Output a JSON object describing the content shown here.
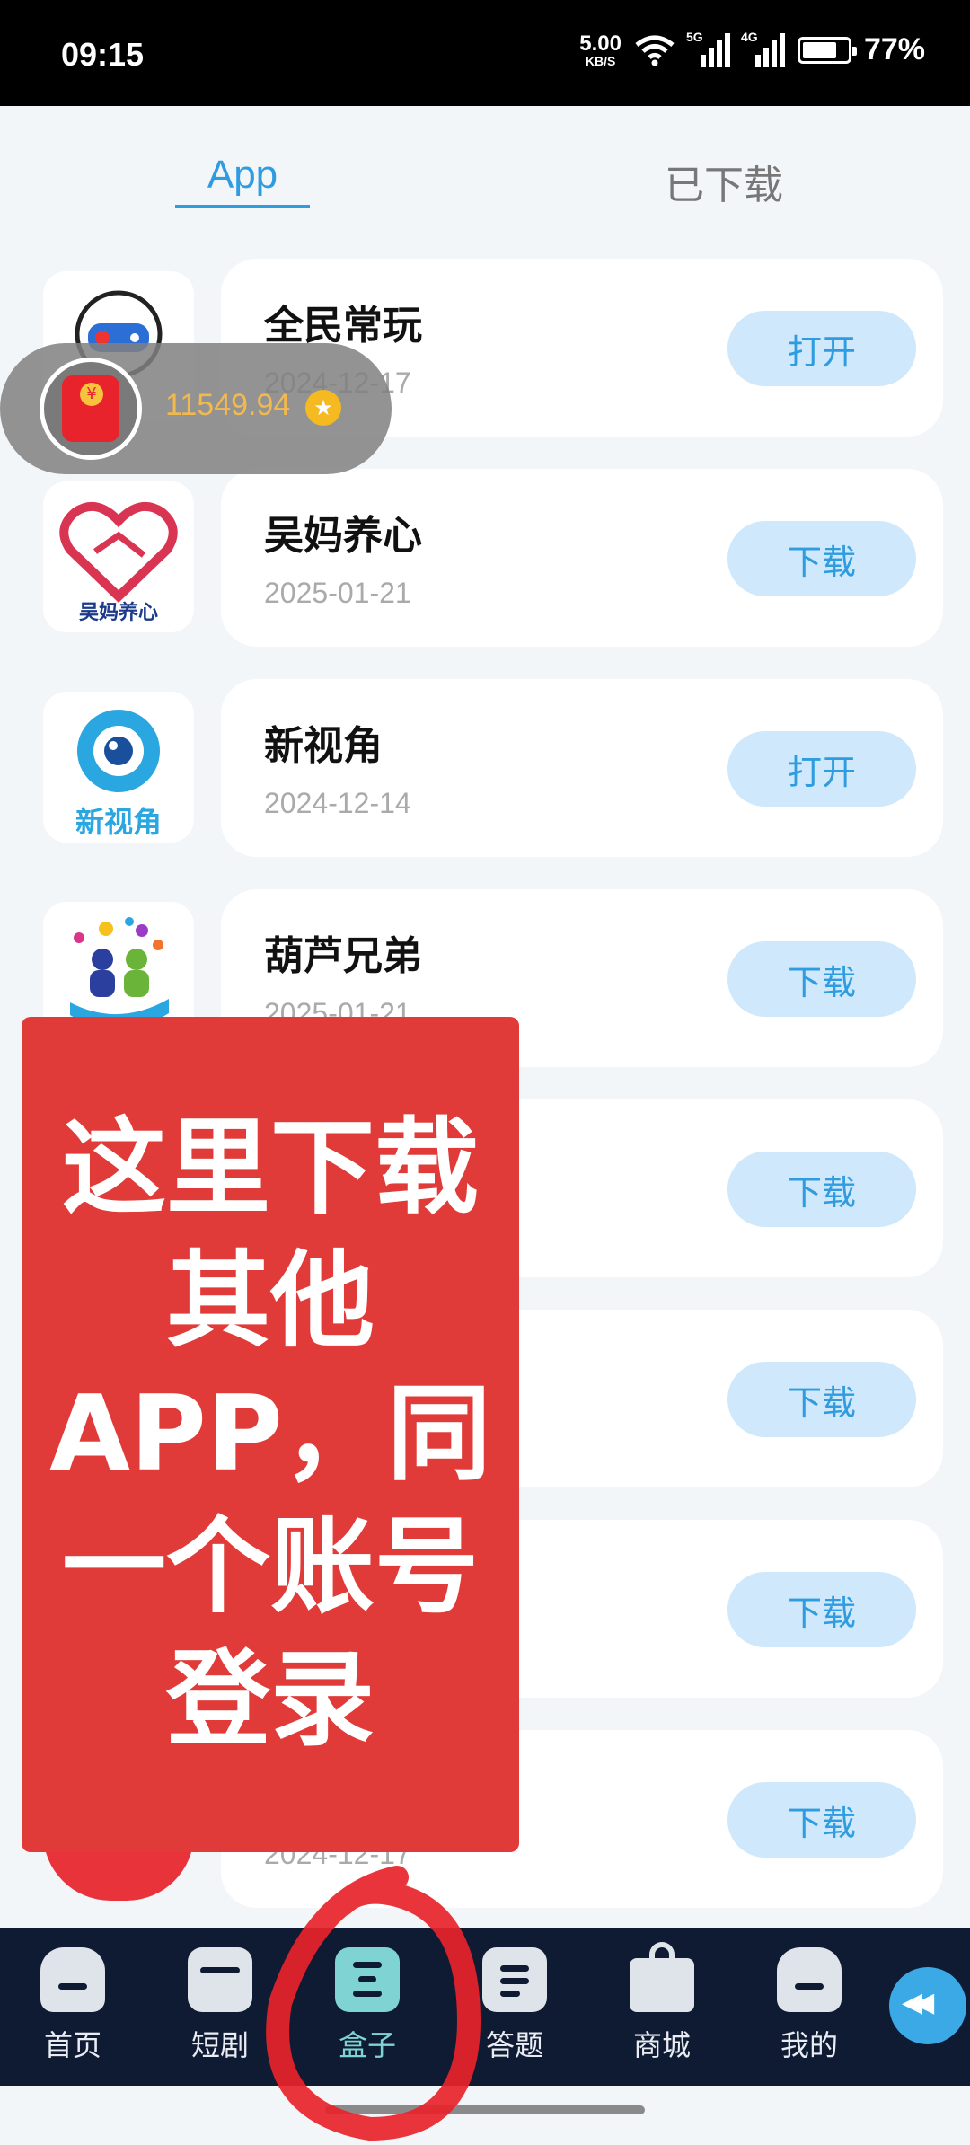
{
  "status_bar": {
    "time": "09:15",
    "net_speed": "5.00",
    "net_unit": "KB/S",
    "sig1_label": "5G",
    "sig2_label": "4G",
    "battery": "77%"
  },
  "tabs": [
    {
      "label": "App"
    },
    {
      "label": "已下载"
    }
  ],
  "apps": [
    {
      "name": "全民常玩",
      "date": "2024-12-17",
      "action": "打开"
    },
    {
      "name": "吴妈养心",
      "date": "2025-01-21",
      "action": "下载",
      "icon_text": "吴妈养心"
    },
    {
      "name": "新视角",
      "date": "2024-12-14",
      "action": "打开",
      "icon_text": "新视角"
    },
    {
      "name": "葫芦兄弟",
      "date": "2025-01-21",
      "action": "下载"
    },
    {
      "name": "",
      "date": "",
      "action": "下载"
    },
    {
      "name": "",
      "date": "",
      "action": "下载"
    },
    {
      "name": "",
      "date": "",
      "action": "下载"
    },
    {
      "name": "",
      "date": "2024-12-17",
      "action": "下载"
    }
  ],
  "coin_widget": {
    "amount": "11549.94"
  },
  "overlay_text": "这里下载其他APP，同一个账号登录",
  "bottom_nav": [
    {
      "label": "首页"
    },
    {
      "label": "短剧"
    },
    {
      "label": "盒子"
    },
    {
      "label": "答题"
    },
    {
      "label": "商城"
    },
    {
      "label": "我的"
    }
  ],
  "colors": {
    "accent": "#2f9ce0",
    "button_bg": "#cfe8fb",
    "nav_bg": "#0f1b33",
    "overlay": "#e03b38",
    "active_nav": "#7fd3d3"
  }
}
